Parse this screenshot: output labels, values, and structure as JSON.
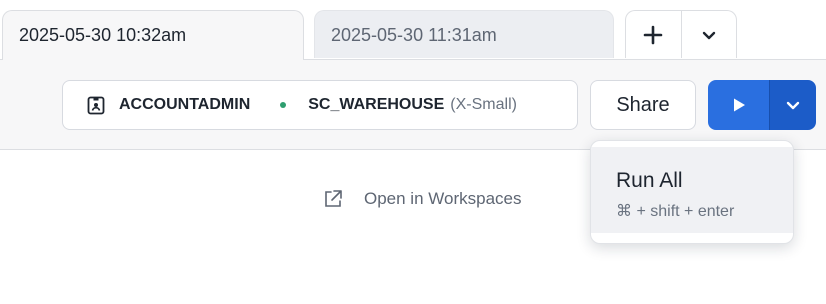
{
  "tabs": [
    {
      "label": "2025-05-30 10:32am",
      "active": true
    },
    {
      "label": "2025-05-30 11:31am",
      "active": false
    }
  ],
  "tab_tools": {
    "add_icon": "plus-icon",
    "menu_icon": "chevron-down-icon"
  },
  "context": {
    "role": "ACCOUNTADMIN",
    "role_icon": "badge-icon",
    "warehouse": "SC_WAREHOUSE",
    "warehouse_size": "(X-Small)",
    "status_color": "#2e9e6f"
  },
  "toolbar": {
    "share_label": "Share",
    "run_icon": "play-icon",
    "run_menu_icon": "chevron-down-icon",
    "accent_color": "#2a6fe0"
  },
  "open_link": {
    "label": "Open in Workspaces",
    "icon": "external-link-icon"
  },
  "run_menu": {
    "items": [
      {
        "label": "Run All",
        "shortcut": "⌘ + shift + enter"
      }
    ]
  }
}
